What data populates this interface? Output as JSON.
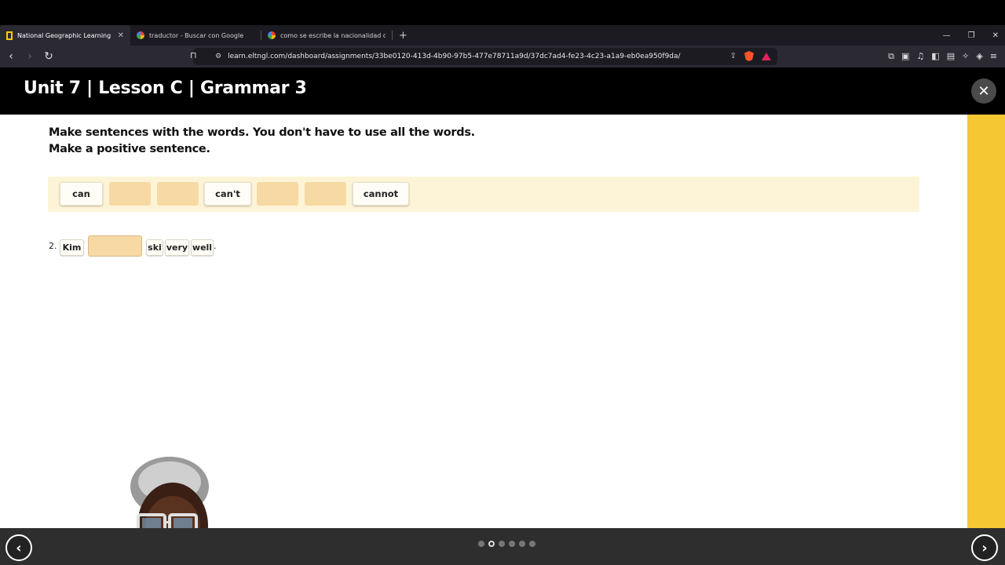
{
  "browser": {
    "tabs": [
      {
        "title": "National Geographic Learning",
        "icon": "natgeo-icon",
        "active": true
      },
      {
        "title": "traductor - Buscar con Google",
        "icon": "google-icon",
        "active": false
      },
      {
        "title": "como se escribe la nacionalidad de",
        "icon": "google-icon",
        "active": false
      }
    ],
    "url": "learn.eltngl.com/dashboard/assignments/33be0120-413d-4b90-97b5-477e78711a9d/37dc7ad4-fe23-4c23-a1a9-eb0ea950f9da/"
  },
  "header": {
    "title": "Unit 7 | Lesson C | Grammar 3"
  },
  "exercise": {
    "instruction_line1": "Make sentences with the words. You don't have to use all the words.",
    "instruction_line2": "Make a positive sentence.",
    "word_bank": [
      "can",
      "",
      "",
      "can't",
      "",
      "",
      "cannot"
    ],
    "question": {
      "number": "2.",
      "words_before": [
        "Kim"
      ],
      "words_after": [
        "ski",
        "very",
        "well"
      ],
      "end_punct": "."
    }
  },
  "footer": {
    "pages": 6,
    "current_page": 2
  },
  "colors": {
    "accent": "#f4c733",
    "bank_bg": "#fdf4d7",
    "slot": "#f7d9a3"
  }
}
